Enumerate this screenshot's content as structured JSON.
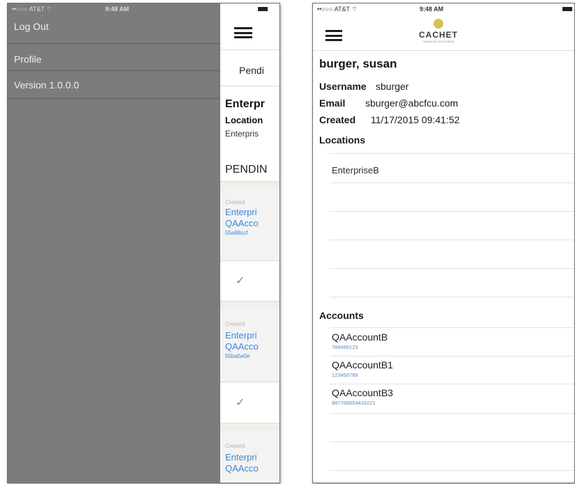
{
  "left": {
    "status": {
      "carrier": "••○○○ AT&T ⌔",
      "time": "9:48 AM"
    },
    "menu": {
      "items": [
        {
          "label": "Log Out"
        },
        {
          "label": "Profile"
        },
        {
          "label": "Version 1.0.0.0"
        }
      ]
    },
    "peek": {
      "pending_tab": "Pendi",
      "enterprise_title": "Enterpr",
      "location_label": "Location",
      "location_value": "Enterpris",
      "pending_header": "PENDIN",
      "cards": [
        {
          "created": "Created",
          "enterprise": "Enterpri",
          "account": "QAAcco",
          "id": "55a98ccf"
        },
        {
          "created": "Created",
          "enterprise": "Enterpri",
          "account": "QAAcco",
          "id": "55ba5e0e"
        },
        {
          "created": "Created",
          "enterprise": "Enterpri",
          "account": "QAAcco"
        }
      ],
      "check": "✓"
    }
  },
  "right": {
    "status": {
      "carrier": "••○○○ AT&T ⌔",
      "time": "9:48 AM"
    },
    "logo": {
      "text": "CACHET",
      "sub": "FINANCIAL SOLUTIONS"
    },
    "user": {
      "name": "burger, susan",
      "username_label": "Username",
      "username": "sburger",
      "email_label": "Email",
      "email": "sburger@abcfcu.com",
      "created_label": "Created",
      "created": "11/17/2015 09:41:52"
    },
    "locations_label": "Locations",
    "locations": [
      "EnterpriseB"
    ],
    "accounts_label": "Accounts",
    "accounts": [
      {
        "name": "QAAccountB",
        "number": "789456123"
      },
      {
        "name": "QAAccountB1",
        "number": "123456789"
      },
      {
        "name": "QAAccountB3",
        "number": "887766554433221"
      }
    ]
  }
}
